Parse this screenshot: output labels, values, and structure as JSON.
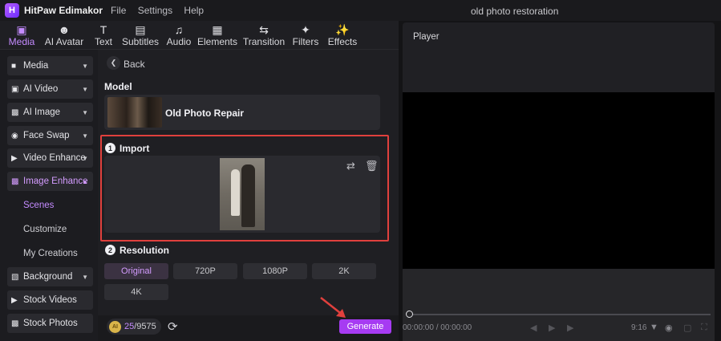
{
  "app": {
    "name": "HitPaw Edimakor",
    "window_title": "old photo restoration",
    "logo_glyph": "H"
  },
  "menu": [
    "File",
    "Settings",
    "Help"
  ],
  "toolbar": [
    {
      "label": "Media",
      "icon": "media-icon",
      "active": true
    },
    {
      "label": "AI Avatar",
      "icon": "avatar-icon"
    },
    {
      "label": "Text",
      "icon": "text-icon"
    },
    {
      "label": "Subtitles",
      "icon": "subtitles-icon"
    },
    {
      "label": "Audio",
      "icon": "audio-icon"
    },
    {
      "label": "Elements",
      "icon": "elements-icon"
    },
    {
      "label": "Transition",
      "icon": "transition-icon"
    },
    {
      "label": "Filters",
      "icon": "filters-icon"
    },
    {
      "label": "Effects",
      "icon": "effects-icon"
    }
  ],
  "sidebar": {
    "items": [
      {
        "label": "Media"
      },
      {
        "label": "AI Video"
      },
      {
        "label": "AI Image"
      },
      {
        "label": "Face Swap"
      },
      {
        "label": "Video Enhance"
      },
      {
        "label": "Image Enhance",
        "expanded": true
      },
      {
        "label": "Background"
      },
      {
        "label": "Stock Videos"
      },
      {
        "label": "Stock Photos"
      }
    ],
    "subitems": [
      {
        "label": "Scenes",
        "active": true
      },
      {
        "label": "Customize"
      },
      {
        "label": "My Creations"
      }
    ]
  },
  "panel": {
    "back_label": "Back",
    "model_title": "Model",
    "model_name": "Old Photo Repair",
    "import_number": "1",
    "import_title": "Import",
    "resolution_number": "2",
    "resolution_title": "Resolution",
    "resolutions": [
      {
        "label": "Original",
        "selected": true
      },
      {
        "label": "720P"
      },
      {
        "label": "1080P"
      },
      {
        "label": "2K"
      },
      {
        "label": "4K"
      }
    ],
    "credits_used": "25",
    "credits_total": "/9575",
    "coin_glyph": "AI",
    "generate_label": "Generate"
  },
  "player": {
    "title": "Player",
    "time": "00:00:00 / 00:00:00",
    "aspect_ratio": "9:16"
  },
  "colors": {
    "accent": "#a63bf2",
    "accent_text": "#c48bff",
    "highlight": "#e0403d"
  }
}
